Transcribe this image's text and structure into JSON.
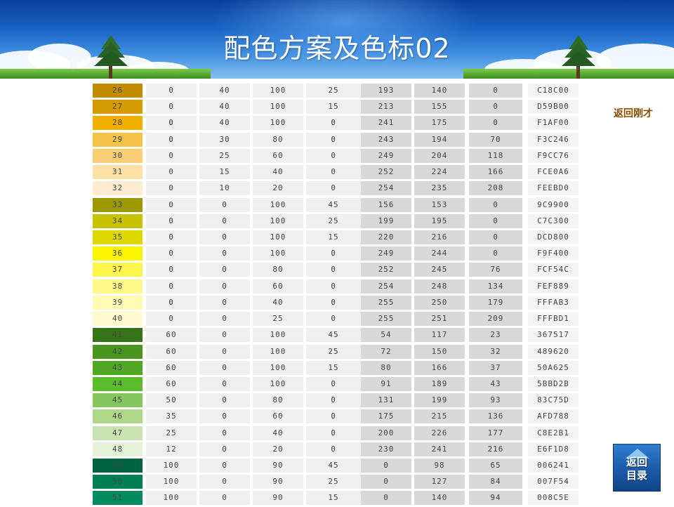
{
  "header": {
    "title": "配色方案及色标02"
  },
  "nav": {
    "back_label": "返回刚才",
    "toc_label": "返回\n目录"
  },
  "table": {
    "rows": [
      {
        "n": "26",
        "v": [
          "0",
          "40",
          "100",
          "25",
          "193",
          "140",
          "0",
          "C18C00"
        ],
        "color": "#C18C00"
      },
      {
        "n": "27",
        "v": [
          "0",
          "40",
          "100",
          "15",
          "213",
          "155",
          "0",
          "D59B00"
        ],
        "color": "#D59B00"
      },
      {
        "n": "28",
        "v": [
          "0",
          "40",
          "100",
          "0",
          "241",
          "175",
          "0",
          "F1AF00"
        ],
        "color": "#F1AF00"
      },
      {
        "n": "29",
        "v": [
          "0",
          "30",
          "80",
          "0",
          "243",
          "194",
          "70",
          "F3C246"
        ],
        "color": "#F3C246"
      },
      {
        "n": "30",
        "v": [
          "0",
          "25",
          "60",
          "0",
          "249",
          "204",
          "118",
          "F9CC76"
        ],
        "color": "#F9CC76"
      },
      {
        "n": "31",
        "v": [
          "0",
          "15",
          "40",
          "0",
          "252",
          "224",
          "166",
          "FCE0A6"
        ],
        "color": "#FCE0A6"
      },
      {
        "n": "32",
        "v": [
          "0",
          "10",
          "20",
          "0",
          "254",
          "235",
          "208",
          "FEEBD0"
        ],
        "color": "#FEEBD0"
      },
      {
        "n": "33",
        "v": [
          "0",
          "0",
          "100",
          "45",
          "156",
          "153",
          "0",
          "9C9900"
        ],
        "color": "#9C9900"
      },
      {
        "n": "34",
        "v": [
          "0",
          "0",
          "100",
          "25",
          "199",
          "195",
          "0",
          "C7C300"
        ],
        "color": "#C7C300"
      },
      {
        "n": "35",
        "v": [
          "0",
          "0",
          "100",
          "15",
          "220",
          "216",
          "0",
          "DCD800"
        ],
        "color": "#DCD800"
      },
      {
        "n": "36",
        "v": [
          "0",
          "0",
          "100",
          "0",
          "249",
          "244",
          "0",
          "F9F400"
        ],
        "color": "#F9F400"
      },
      {
        "n": "37",
        "v": [
          "0",
          "0",
          "80",
          "0",
          "252",
          "245",
          "76",
          "FCF54C"
        ],
        "color": "#FCF54C"
      },
      {
        "n": "38",
        "v": [
          "0",
          "0",
          "60",
          "0",
          "254",
          "248",
          "134",
          "FEF889"
        ],
        "color": "#FEF889"
      },
      {
        "n": "39",
        "v": [
          "0",
          "0",
          "40",
          "0",
          "255",
          "250",
          "179",
          "FFFAB3"
        ],
        "color": "#FFFAB3"
      },
      {
        "n": "40",
        "v": [
          "0",
          "0",
          "25",
          "0",
          "255",
          "251",
          "209",
          "FFFBD1"
        ],
        "color": "#FFFBD1"
      },
      {
        "n": "41",
        "v": [
          "60",
          "0",
          "100",
          "45",
          "54",
          "117",
          "23",
          "367517"
        ],
        "color": "#367517"
      },
      {
        "n": "42",
        "v": [
          "60",
          "0",
          "100",
          "25",
          "72",
          "150",
          "32",
          "489620"
        ],
        "color": "#489620"
      },
      {
        "n": "43",
        "v": [
          "60",
          "0",
          "100",
          "15",
          "80",
          "166",
          "37",
          "50A625"
        ],
        "color": "#50A625"
      },
      {
        "n": "44",
        "v": [
          "60",
          "0",
          "100",
          "0",
          "91",
          "189",
          "43",
          "5BBD2B"
        ],
        "color": "#5BBD2B"
      },
      {
        "n": "45",
        "v": [
          "50",
          "0",
          "80",
          "0",
          "131",
          "199",
          "93",
          "83C75D"
        ],
        "color": "#83C75D"
      },
      {
        "n": "46",
        "v": [
          "35",
          "0",
          "60",
          "0",
          "175",
          "215",
          "136",
          "AFD788"
        ],
        "color": "#AFD788"
      },
      {
        "n": "47",
        "v": [
          "25",
          "0",
          "40",
          "0",
          "200",
          "226",
          "177",
          "C8E2B1"
        ],
        "color": "#C8E2B1"
      },
      {
        "n": "48",
        "v": [
          "12",
          "0",
          "20",
          "0",
          "230",
          "241",
          "216",
          "E6F1D8"
        ],
        "color": "#E6F1D8"
      },
      {
        "n": "49",
        "v": [
          "100",
          "0",
          "90",
          "45",
          "0",
          "98",
          "65",
          "006241"
        ],
        "color": "#006241"
      },
      {
        "n": "50",
        "v": [
          "100",
          "0",
          "90",
          "25",
          "0",
          "127",
          "84",
          "007F54"
        ],
        "color": "#007F54"
      },
      {
        "n": "51",
        "v": [
          "100",
          "0",
          "90",
          "15",
          "0",
          "140",
          "94",
          "008C5E"
        ],
        "color": "#008C5E"
      }
    ]
  }
}
